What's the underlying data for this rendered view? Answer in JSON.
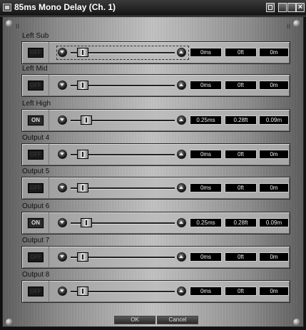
{
  "window": {
    "title": "85ms Mono Delay (Ch. 1)"
  },
  "header": {
    "left_glyph": "II",
    "right_glyph": "II"
  },
  "channels": [
    {
      "label": "Left Sub",
      "toggle": "OFF",
      "ms": "0ms",
      "ft": "0ft",
      "m": "0m"
    },
    {
      "label": "Left Mid",
      "toggle": "OFF",
      "ms": "0ms",
      "ft": "0ft",
      "m": "0m"
    },
    {
      "label": "Left High",
      "toggle": "ON",
      "ms": "0.25ms",
      "ft": "0.28ft",
      "m": "0.09m"
    },
    {
      "label": "Output 4",
      "toggle": "OFF",
      "ms": "0ms",
      "ft": "0ft",
      "m": "0m"
    },
    {
      "label": "Output 5",
      "toggle": "OFF",
      "ms": "0ms",
      "ft": "0ft",
      "m": "0m"
    },
    {
      "label": "Output 6",
      "toggle": "ON",
      "ms": "0.25ms",
      "ft": "0.28ft",
      "m": "0.09m"
    },
    {
      "label": "Output 7",
      "toggle": "OFF",
      "ms": "0ms",
      "ft": "0ft",
      "m": "0m"
    },
    {
      "label": "Output 8",
      "toggle": "OFF",
      "ms": "0ms",
      "ft": "0ft",
      "m": "0m"
    }
  ],
  "footer": {
    "ok_label": "OK",
    "cancel_label": "Cancel"
  }
}
